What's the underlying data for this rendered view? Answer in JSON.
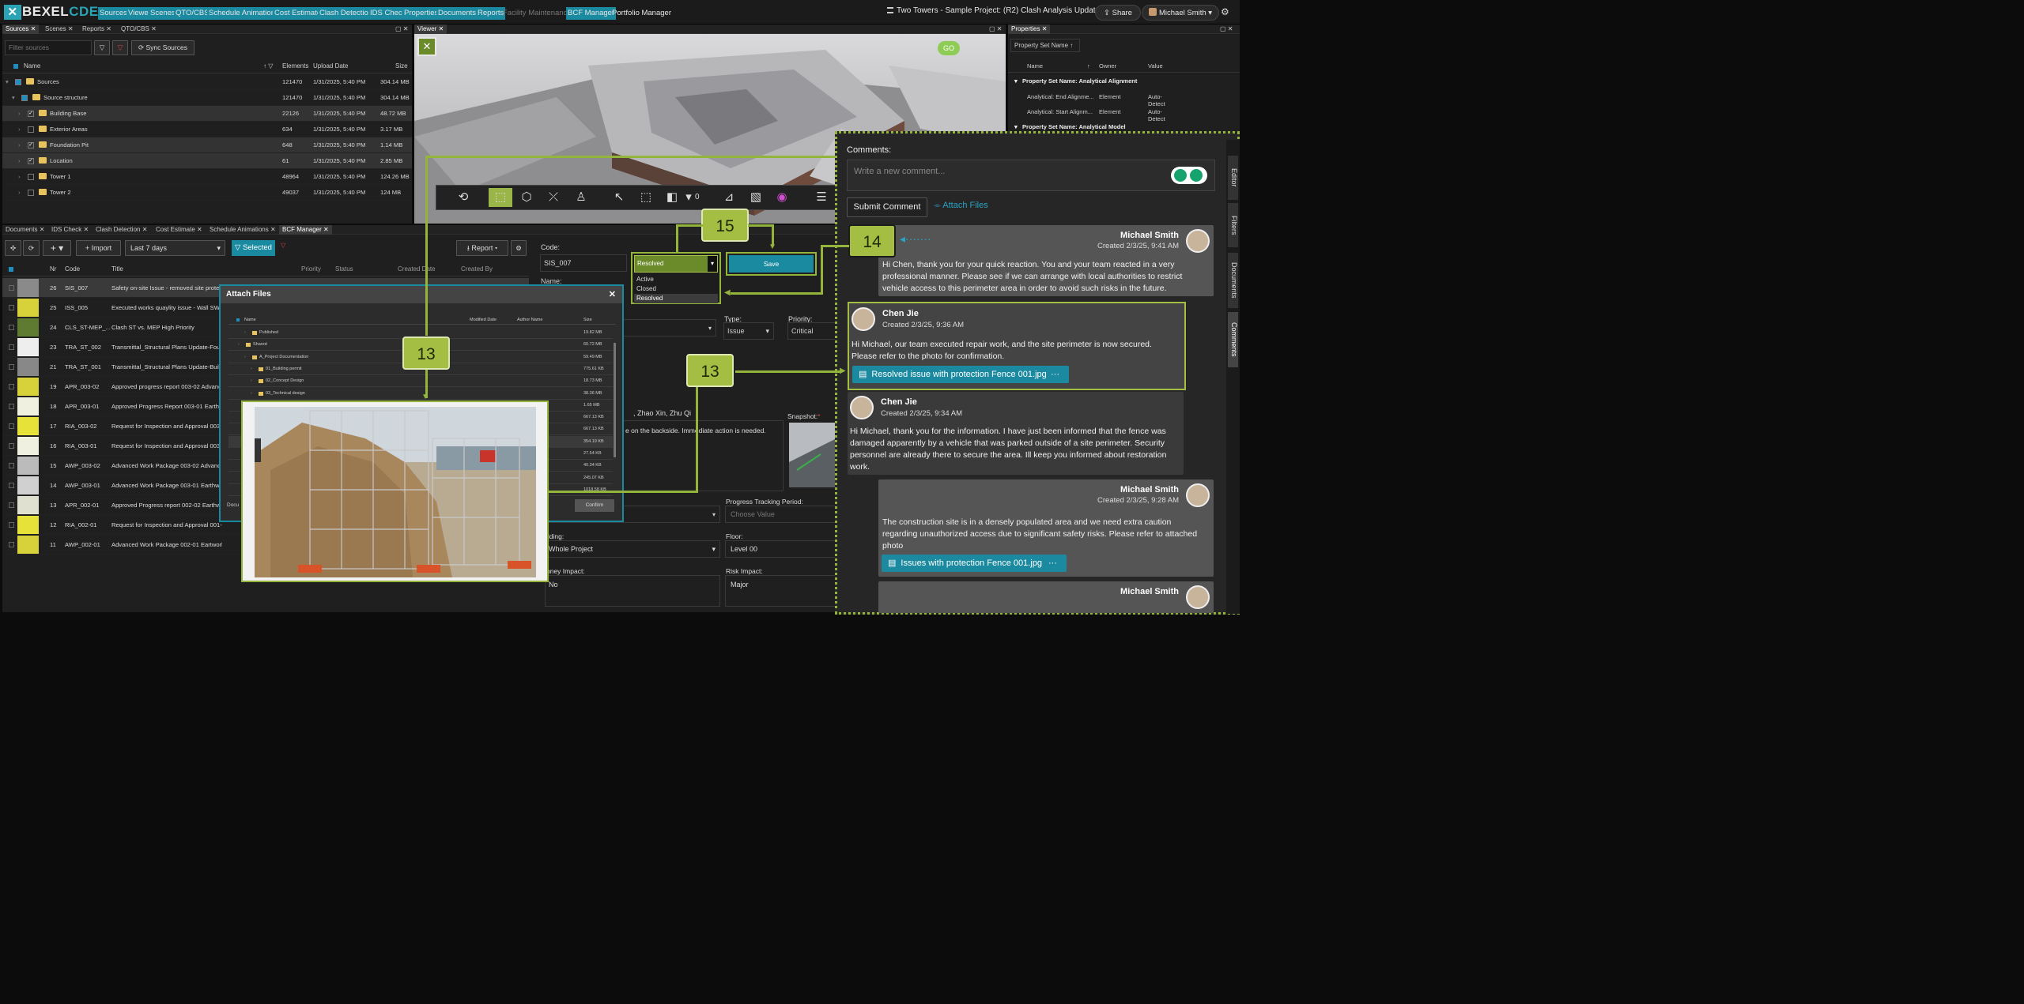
{
  "app": {
    "logo_a": "BEXEL",
    "logo_b": "CDE",
    "logo_x": "✕",
    "title": "Two Towers - Sample Project: (R2) Clash Analysis Update",
    "share": "Share",
    "user": "Michael Smith"
  },
  "nav": [
    "Sources",
    "Viewer",
    "Scenes",
    "QTO/CBS",
    "Schedule Animations",
    "Cost Estimate",
    "Clash Detection",
    "IDS Check",
    "Properties",
    "Documents",
    "Reports",
    "Facility Maintenance",
    "BCF Manager",
    "Portfolio Manager"
  ],
  "sources_panel": {
    "tabs": [
      "Sources",
      "Scenes",
      "Reports",
      "QTO/CBS"
    ],
    "filter_placeholder": "Filter sources",
    "sync": "Sync Sources",
    "cols": [
      "Name",
      "Elements",
      "Upload Date",
      "Size"
    ],
    "rows": [
      {
        "name": "Sources",
        "el": "121470",
        "date": "1/31/2025, 5:40 PM",
        "size": "304.14 MB"
      },
      {
        "name": "Source structure",
        "el": "121470",
        "date": "1/31/2025, 5:40 PM",
        "size": "304.14 MB"
      },
      {
        "name": "Building Base",
        "el": "22126",
        "date": "1/31/2025, 5:40 PM",
        "size": "48.72 MB"
      },
      {
        "name": "Exterior Areas",
        "el": "634",
        "date": "1/31/2025, 5:40 PM",
        "size": "3.17 MB"
      },
      {
        "name": "Foundation Pit",
        "el": "648",
        "date": "1/31/2025, 5:40 PM",
        "size": "1.14 MB"
      },
      {
        "name": "Location",
        "el": "61",
        "date": "1/31/2025, 5:40 PM",
        "size": "2.85 MB"
      },
      {
        "name": "Tower 1",
        "el": "48964",
        "date": "1/31/2025, 5:40 PM",
        "size": "124.26 MB"
      },
      {
        "name": "Tower 2",
        "el": "49037",
        "date": "1/31/2025, 5:40 PM",
        "size": "124 MB"
      }
    ]
  },
  "viewer": {
    "tab": "Viewer",
    "count": "0"
  },
  "properties": {
    "tab": "Properties",
    "search": "Property Set Name",
    "cols": [
      "Name",
      "Owner",
      "Value"
    ],
    "group1": "Property Set Name: Analytical Alignment",
    "rows": [
      [
        "Analytical: End Alignme...",
        "Element",
        "Auto-Detect"
      ],
      [
        "Analytical: Start Alignm...",
        "Element",
        "Auto-Detect"
      ]
    ],
    "group2": "Property Set Name: Analytical Model"
  },
  "bottom_tabs": [
    "Documents",
    "IDS Check",
    "Clash Detection",
    "Cost Estimate",
    "Schedule Animations",
    "BCF Manager"
  ],
  "bcf": {
    "import": "Import",
    "range": "Last 7 days",
    "selected": "Selected",
    "report": "Report",
    "cols": [
      "Nr",
      "Code",
      "Title",
      "Priority",
      "Status",
      "Created Date",
      "Created By"
    ],
    "rows": [
      [
        "26",
        "SIS_007",
        "Safety on-site Issue - removed site prote"
      ],
      [
        "25",
        "ISS_005",
        "Executed works quaylity issue - Wall SW_"
      ],
      [
        "24",
        "CLS_ST-MEP_...",
        "Clash ST vs. MEP High Priority"
      ],
      [
        "23",
        "TRA_ST_002",
        "Transmittal_Structural Plans Update-Foun"
      ],
      [
        "21",
        "TRA_ST_001",
        "Transmittal_Structural Plans Update-Build"
      ],
      [
        "19",
        "APR_003-02",
        "Approved progress report 003-02 Advanc"
      ],
      [
        "18",
        "APR_003-01",
        "Approved Progress Report 003-01 Earthw"
      ],
      [
        "17",
        "RIA_003-02",
        "Request for Inspection and Approval 003"
      ],
      [
        "16",
        "RIA_003-01",
        "Request for Inspection and Approval 003"
      ],
      [
        "15",
        "AWP_003-02",
        "Advanced Work Package 003-02 Advance"
      ],
      [
        "14",
        "AWP_003-01",
        "Advanced Work Package 003-01 Earthwo"
      ],
      [
        "13",
        "APR_002-01",
        "Approved Progress report 002-02 Earthw"
      ],
      [
        "12",
        "RIA_002-01",
        "Request for Inspection and Approval 001-01 Earthw"
      ],
      [
        "11",
        "AWP_002-01",
        "Advanced Work Package 002-01 Eartworks Inc."
      ]
    ]
  },
  "issue_form": {
    "code_label": "Code:",
    "code": "SIS_007",
    "name_label": "Name:",
    "status": "Resolved",
    "status_opts": [
      "Active",
      "Closed",
      "Resolved"
    ],
    "save": "Save",
    "type_label": "Type:",
    "type": "Issue",
    "priority_label": "Priority:",
    "priority": "Critical",
    "assignees": ", Zhao  Xin, Zhu  Qi",
    "desc": "e on the backside. Immediate action is needed.",
    "snapshot_label": "Snapshot:",
    "progress_label": "Progress Tracking Period:",
    "progress_ph": "Choose Value",
    "building_label": "ilding:",
    "building": "Whole Project",
    "floor_label": "Floor:",
    "floor": "Level 00",
    "money_label": "oney Impact:",
    "money": "No",
    "risk_label": "Risk Impact:",
    "risk": "Major"
  },
  "attach_dialog": {
    "title": "Attach Files",
    "cols": [
      "Name",
      "Modified Date",
      "Author Name",
      "Size"
    ],
    "rows": [
      [
        "Published",
        "",
        "19.82 MB"
      ],
      [
        "Shared",
        "",
        "60.72 MB"
      ],
      [
        "A_Project Documentation",
        "",
        "59.49 MB"
      ],
      [
        "01_Building permit",
        "",
        "775.61 KB"
      ],
      [
        "02_Concept Design",
        "",
        "18.73 MB"
      ],
      [
        "03_Technical design",
        "",
        "38.36 MB"
      ],
      [
        "",
        "",
        "1.65 MB"
      ],
      [
        "",
        "",
        "667.13 KB"
      ],
      [
        "",
        "",
        "667.13 KB"
      ],
      [
        "",
        "",
        "354.19 KB"
      ],
      [
        "",
        "",
        "27.54 KB"
      ],
      [
        "",
        "",
        "40.34 KB"
      ],
      [
        "",
        "",
        "245.07 KB"
      ],
      [
        "",
        "",
        "1018.58 KB"
      ]
    ],
    "confirm": "Confirm",
    "docu": "Docu"
  },
  "callouts": {
    "c15": "15",
    "c14": "14",
    "c13a": "13",
    "c13b": "13"
  },
  "comments": {
    "label": "Comments:",
    "placeholder": "Write a new comment...",
    "submit": "Submit Comment",
    "attach": "Attach Files",
    "items": [
      {
        "author": "Michael Smith",
        "created": "Created 2/3/25, 9:41 AM",
        "text": "Hi Chen, thank you for your quick reaction. You and your team reacted in a very professional manner. Please see if we can arrange with local authorities to restrict vehicle access to this perimeter area in order to avoid such risks in the future."
      },
      {
        "author": "Chen Jie",
        "created": "Created 2/3/25, 9:36 AM",
        "text": "Hi Michael, our team executed repair work, and the site perimeter is now secured. Please refer to the photo for confirmation.",
        "file": "Resolved issue with protection Fence 001.jpg"
      },
      {
        "author": "Chen Jie",
        "created": "Created 2/3/25, 9:34 AM",
        "text": "Hi Michael, thank you for the information. I have just been informed that the fence was damaged apparently by a vehicle that was parked outside of a site perimeter. Security personnel are already there to secure the area. Ill keep you informed about restoration work."
      },
      {
        "author": "Michael Smith",
        "created": "Created 2/3/25, 9:28 AM",
        "text": "The construction site is in a densely populated area and we need extra caution regarding unauthorized access due to significant safety risks. Please refer to attached photo",
        "file": "Issues with protection Fence 001.jpg"
      },
      {
        "author": "Michael Smith"
      }
    ]
  },
  "side_tabs": [
    "Editor",
    "Filters",
    "Documents",
    "Comments"
  ]
}
